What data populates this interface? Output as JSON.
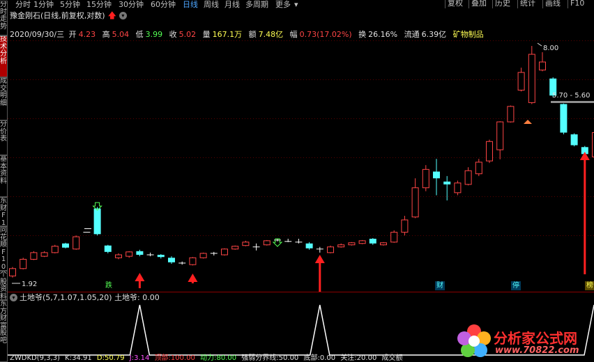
{
  "periods": [
    "分时",
    "1分钟",
    "5分钟",
    "15分钟",
    "30分钟",
    "60分钟",
    "日线",
    "周线",
    "月线",
    "多周期",
    "更多"
  ],
  "active_period": "日线",
  "right_toolbar": [
    "复权",
    "叠加",
    "历史",
    "统计",
    "画线",
    "F10"
  ],
  "left_tabs": [
    "分时走势",
    "技术分析",
    "成交明细",
    "分价表",
    "基本资料",
    "东财F10",
    "同花顺F10",
    "个股资料",
    "东方财富股吧"
  ],
  "title": "豫金刚石(日线,前复权,对数)",
  "info": {
    "date": "2020/09/30/三",
    "open_label": "开",
    "open": "4.23",
    "high_label": "高",
    "high": "5.04",
    "low_label": "低",
    "low": "3.99",
    "close_label": "收",
    "close": "5.02",
    "vol_label": "量",
    "vol": "167.1万",
    "amount_label": "额",
    "amount": "7.48亿",
    "change_label": "幅",
    "change": "0.73(17.02%)",
    "turnover_label": "换",
    "turnover": "26.16%",
    "float_label": "流通",
    "float": "6.39亿",
    "sector": "矿物制品"
  },
  "chart_annotations": {
    "high_mark": "8.00",
    "low_mark": "1.92",
    "range_label": "5.70 - 5.60"
  },
  "event_tags": [
    "跌",
    "财",
    "停",
    "榜"
  ],
  "indicator": {
    "title": "土地爷(5,7,1.07,1.05,20)",
    "value_label": "土地爷:",
    "value": "0.00"
  },
  "bottom_indicator": [
    "ZWDKD(9,3,3)",
    "K:34.91",
    "D:50.79",
    "J:3.14",
    "顶部:100.00",
    "动力:80.00",
    "强弱分界线:50.00",
    "底部:0.00",
    "关注:20.00",
    "成交额"
  ],
  "watermark": {
    "text": "分析家公式网",
    "url": "www.70822.com"
  },
  "colors": {
    "up": "#ff4545",
    "down": "#54ffff",
    "arrow": "#ff2020",
    "signal": "#ffffff",
    "accent": "#4da6ff",
    "yellow": "#ffff54"
  },
  "chart_data": {
    "type": "candlestick",
    "scale": "log",
    "ylim": [
      1.92,
      8.0
    ],
    "candles": [
      {
        "o": 1.95,
        "c": 2.04,
        "h": 2.06,
        "l": 1.93
      },
      {
        "o": 2.04,
        "c": 2.16,
        "h": 2.18,
        "l": 2.03
      },
      {
        "o": 2.16,
        "c": 2.25,
        "h": 2.27,
        "l": 2.15
      },
      {
        "o": 2.2,
        "c": 2.25,
        "h": 2.27,
        "l": 2.19
      },
      {
        "o": 2.25,
        "c": 2.34,
        "h": 2.36,
        "l": 2.24
      },
      {
        "o": 2.38,
        "c": 2.32,
        "h": 2.39,
        "l": 2.31
      },
      {
        "o": 2.3,
        "c": 2.48,
        "h": 2.5,
        "l": 2.29
      },
      {
        "o": 2.55,
        "c": 2.55,
        "h": 2.55,
        "l": 2.55
      },
      {
        "o": 2.95,
        "c": 2.52,
        "h": 2.98,
        "l": 2.5
      },
      {
        "o": 2.35,
        "c": 2.26,
        "h": 2.36,
        "l": 2.24
      },
      {
        "o": 2.18,
        "c": 2.22,
        "h": 2.24,
        "l": 2.16
      },
      {
        "o": 2.2,
        "c": 2.26,
        "h": 2.27,
        "l": 2.18
      },
      {
        "o": 2.27,
        "c": 2.22,
        "h": 2.29,
        "l": 2.2
      },
      {
        "o": 2.22,
        "c": 2.22,
        "h": 2.25,
        "l": 2.2
      },
      {
        "o": 2.22,
        "c": 2.19,
        "h": 2.23,
        "l": 2.17
      },
      {
        "o": 2.18,
        "c": 2.12,
        "h": 2.2,
        "l": 2.1
      },
      {
        "o": 2.11,
        "c": 2.11,
        "h": 2.13,
        "l": 2.09
      },
      {
        "o": 2.09,
        "c": 2.18,
        "h": 2.19,
        "l": 2.08
      },
      {
        "o": 2.18,
        "c": 2.24,
        "h": 2.25,
        "l": 2.17
      },
      {
        "o": 2.24,
        "c": 2.24,
        "h": 2.26,
        "l": 2.21
      },
      {
        "o": 2.22,
        "c": 2.3,
        "h": 2.31,
        "l": 2.21
      },
      {
        "o": 2.3,
        "c": 2.34,
        "h": 2.35,
        "l": 2.29
      },
      {
        "o": 2.35,
        "c": 2.4,
        "h": 2.42,
        "l": 2.34
      },
      {
        "o": 2.33,
        "c": 2.33,
        "h": 2.38,
        "l": 2.28
      },
      {
        "o": 2.36,
        "c": 2.42,
        "h": 2.43,
        "l": 2.35
      },
      {
        "o": 2.43,
        "c": 2.43,
        "h": 2.45,
        "l": 2.41
      },
      {
        "o": 2.41,
        "c": 2.41,
        "h": 2.45,
        "l": 2.4
      },
      {
        "o": 2.4,
        "c": 2.4,
        "h": 2.45,
        "l": 2.38
      },
      {
        "o": 2.38,
        "c": 2.31,
        "h": 2.4,
        "l": 2.29
      },
      {
        "o": 2.3,
        "c": 2.3,
        "h": 2.33,
        "l": 2.25
      },
      {
        "o": 2.25,
        "c": 2.33,
        "h": 2.35,
        "l": 2.24
      },
      {
        "o": 2.33,
        "c": 2.36,
        "h": 2.38,
        "l": 2.32
      },
      {
        "o": 2.36,
        "c": 2.39,
        "h": 2.4,
        "l": 2.35
      },
      {
        "o": 2.38,
        "c": 2.42,
        "h": 2.43,
        "l": 2.37
      },
      {
        "o": 2.45,
        "c": 2.38,
        "h": 2.46,
        "l": 2.36
      },
      {
        "o": 2.36,
        "c": 2.39,
        "h": 2.4,
        "l": 2.35
      },
      {
        "o": 2.4,
        "c": 2.55,
        "h": 2.58,
        "l": 2.39
      },
      {
        "o": 2.55,
        "c": 2.75,
        "h": 2.82,
        "l": 2.5
      },
      {
        "o": 2.8,
        "c": 3.35,
        "h": 3.55,
        "l": 2.78
      },
      {
        "o": 3.35,
        "c": 3.75,
        "h": 3.85,
        "l": 3.28
      },
      {
        "o": 3.7,
        "c": 3.55,
        "h": 4.0,
        "l": 3.2
      },
      {
        "o": 3.48,
        "c": 3.42,
        "h": 3.6,
        "l": 3.1
      },
      {
        "o": 3.25,
        "c": 3.45,
        "h": 3.5,
        "l": 3.2
      },
      {
        "o": 3.42,
        "c": 3.72,
        "h": 3.8,
        "l": 3.4
      },
      {
        "o": 3.65,
        "c": 3.92,
        "h": 4.0,
        "l": 3.6
      },
      {
        "o": 3.95,
        "c": 4.45,
        "h": 4.5,
        "l": 3.9
      },
      {
        "o": 4.23,
        "c": 5.02,
        "h": 5.04,
        "l": 3.99
      },
      {
        "o": 5.02,
        "c": 5.52,
        "h": 5.55,
        "l": 5.0
      },
      {
        "o": 6.1,
        "c": 6.8,
        "h": 7.0,
        "l": 6.05
      },
      {
        "o": 5.65,
        "c": 7.6,
        "h": 8.0,
        "l": 5.6
      },
      {
        "o": 6.9,
        "c": 7.25,
        "h": 7.7,
        "l": 6.85
      },
      {
        "o": 6.55,
        "c": 5.9,
        "h": 6.6,
        "l": 5.85
      },
      {
        "o": 5.6,
        "c": 4.7,
        "h": 5.62,
        "l": 4.65
      },
      {
        "o": 4.65,
        "c": 4.35,
        "h": 4.68,
        "l": 4.32
      },
      {
        "o": 4.3,
        "c": 4.12,
        "h": 4.33,
        "l": 4.08
      },
      {
        "o": 4.05,
        "c": 4.7,
        "h": 4.75,
        "l": 3.8
      }
    ],
    "indicator_spikes": [
      12,
      29,
      55
    ]
  }
}
